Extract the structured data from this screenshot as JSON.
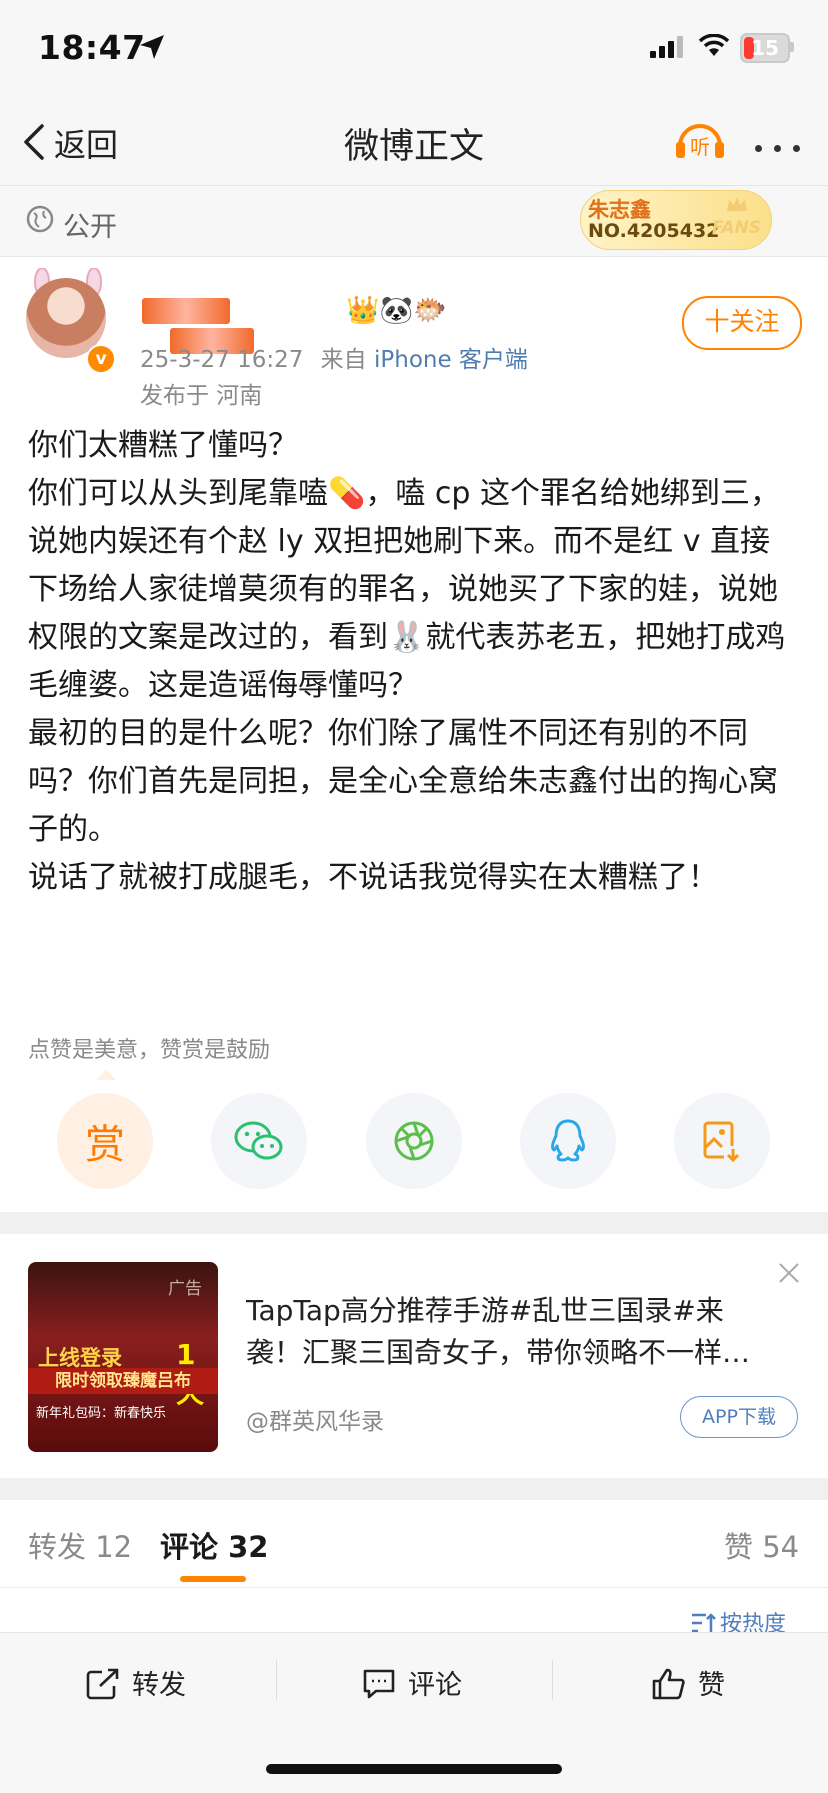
{
  "status_bar": {
    "time": "18:47",
    "battery": "15"
  },
  "nav": {
    "back_label": "返回",
    "title": "微博正文",
    "listen_label": "听"
  },
  "visibility": {
    "label": "公开"
  },
  "fans_badge": {
    "name": "朱志鑫",
    "number": "NO.4205432",
    "word": "FANS"
  },
  "author": {
    "date": "25-3-27 16:27",
    "from_prefix": "来自",
    "client": "iPhone 客户端",
    "location": "发布于 河南",
    "verify_mark": "v",
    "emojis": "👑🐼🐡"
  },
  "follow_button": {
    "label": "十关注"
  },
  "post": {
    "paragraphs": [
      "你们太糟糕了懂吗？",
      "你们可以从头到尾靠嗑💊，嗑 cp 这个罪名给她绑到三，说她内娱还有个赵 ly 双担把她刷下来。而不是红 v 直接下场给人家徒增莫须有的罪名，说她买了下家的娃，说她权限的文案是改过的，看到🐰就代表苏老五，把她打成鸡毛缠婆。这是造谣侮辱懂吗？",
      "最初的目的是什么呢？你们除了属性不同还有别的不同吗？你们首先是同担，是全心全意给朱志鑫付出的掏心窝子的。",
      "说话了就被打成腿毛，不说话我觉得实在太糟糕了！"
    ]
  },
  "reward": {
    "tip": "点赞是美意，赞赏是鼓励",
    "button_char": "赏"
  },
  "share_icons": [
    "wechat-icon",
    "moments-icon",
    "qq-icon",
    "save-image-icon"
  ],
  "ad": {
    "tag": "广告",
    "image_title": "上线登录",
    "image_day": "1天",
    "image_strip": "限时领取臻魔吕布",
    "image_sub": "新年礼包码：新春快乐",
    "line1": "TapTap高分推荐手游#乱世三国录#来",
    "line2": "袭！汇聚三国奇女子，带你领略不一样…",
    "account": "@群英风华录",
    "download": "APP下载"
  },
  "tabs": {
    "repost": "转发 12",
    "comment": "评论 32",
    "like": "赞 54"
  },
  "sort": {
    "label": "按热度"
  },
  "bottom_bar": {
    "repost": "转发",
    "comment": "评论",
    "like": "赞"
  },
  "colors": {
    "accent": "#ff8200",
    "link": "#507daf",
    "text": "#1a1a1a",
    "muted": "#8a8a8a"
  }
}
